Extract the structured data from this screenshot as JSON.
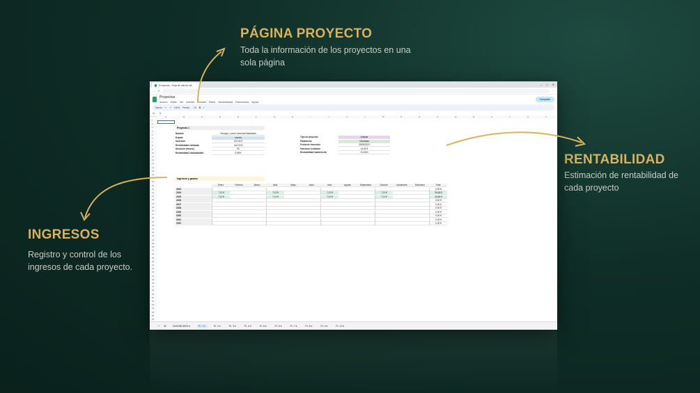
{
  "callouts": {
    "pagina": {
      "title": "PÁGINA PROYECTO",
      "desc1": "Toda la información de los proyectos en una",
      "desc2": "sola página"
    },
    "rentabilidad": {
      "title": "RENTABILIDAD",
      "desc1": "Estimación de rentabilidad de",
      "desc2": "cada proyecto"
    },
    "ingresos": {
      "title": "INGRESOS",
      "desc1": "Registro y control de los",
      "desc2": "ingresos de cada proyecto."
    }
  },
  "colors": {
    "accent": "#d9b25e",
    "bg": "#0f2e27"
  },
  "browser": {
    "tab_title": "Proyectos - Hoja de cálculo de"
  },
  "doc": {
    "title": "Proyectos",
    "menus": [
      "Archivo",
      "Editar",
      "Ver",
      "Insertar",
      "Formato",
      "Datos",
      "Herramientas",
      "Extensiones",
      "Ayuda"
    ],
    "share": "Compartir",
    "toolbar": {
      "menu": "Menús",
      "zoom": "100%",
      "font": "Predet...",
      "size": "10"
    },
    "cellref": "A1"
  },
  "project": {
    "title": "Proyecto 1",
    "left_labels": [
      "Nombre",
      "Estado",
      "Inversión",
      "Rentabilidad estimada",
      "Duración (meses)",
      "Rentabilidad estimada/año"
    ],
    "left_values": [
      "Vizcaya | Local Comercial Barakaldo",
      "Invertir",
      "100,00 €",
      "140,00 €",
      "60",
      "5,95%"
    ],
    "right_labels": [
      "Tipo de proyecto",
      "Plataforma",
      "Fecha de Inversión",
      "Intereses recibidos",
      "Rentabilidad hasta fecha"
    ],
    "right_values": [
      "Ampliar",
      "Urbanitae",
      "30/06/2023",
      "18,90 €",
      "31,53%"
    ]
  },
  "ingresos": {
    "title": "Ingresos y gastos",
    "months": [
      "Enero",
      "Febrero",
      "Marzo",
      "Abril",
      "Mayo",
      "Junio",
      "Julio",
      "Agosto",
      "Septiembre",
      "Octubre",
      "Noviembre",
      "Diciembre",
      "Total"
    ],
    "years": [
      "2023",
      "2024",
      "2025",
      "2026",
      "2027",
      "2028",
      "2029",
      "2030",
      "2031",
      "2032"
    ],
    "rows": [
      [
        "",
        "",
        "",
        "",
        "",
        "",
        "",
        "",
        "",
        "",
        "",
        "",
        "0,00 €"
      ],
      [
        "7,12 €",
        "",
        "",
        "7,12 €",
        "",
        "",
        "7,12 €",
        "",
        "",
        "7,12 €",
        "",
        "",
        "28,48 €"
      ],
      [
        "7,12 €",
        "",
        "",
        "7,12 €",
        "",
        "",
        "7,12 €",
        "",
        "",
        "7,12 €",
        "",
        "",
        "28,48 €"
      ],
      [
        "",
        "",
        "",
        "",
        "",
        "",
        "",
        "",
        "",
        "",
        "",
        "",
        "0,00 €"
      ],
      [
        "",
        "",
        "",
        "",
        "",
        "",
        "",
        "",
        "",
        "",
        "",
        "",
        "0,00 €"
      ],
      [
        "",
        "",
        "",
        "",
        "",
        "",
        "",
        "",
        "",
        "",
        "",
        "",
        "0,00 €"
      ],
      [
        "",
        "",
        "",
        "",
        "",
        "",
        "",
        "",
        "",
        "",
        "",
        "",
        "0,00 €"
      ],
      [
        "",
        "",
        "",
        "",
        "",
        "",
        "",
        "",
        "",
        "",
        "",
        "",
        "0,00 €"
      ],
      [
        "",
        "",
        "",
        "",
        "",
        "",
        "",
        "",
        "",
        "",
        "",
        "",
        "0,00 €"
      ],
      [
        "",
        "",
        "",
        "",
        "",
        "",
        "",
        "",
        "",
        "",
        "",
        "",
        "0,00 €"
      ]
    ]
  },
  "sheet_tabs": [
    "DASHBOARD",
    "Pr. 1",
    "Pr. 2",
    "Pr. 3",
    "Pr. 4",
    "Pr. 5",
    "Pr. 6",
    "Pr. 7",
    "Pr. 8",
    "Pr. 9",
    "Pr. 10"
  ],
  "sheet_count": "30"
}
